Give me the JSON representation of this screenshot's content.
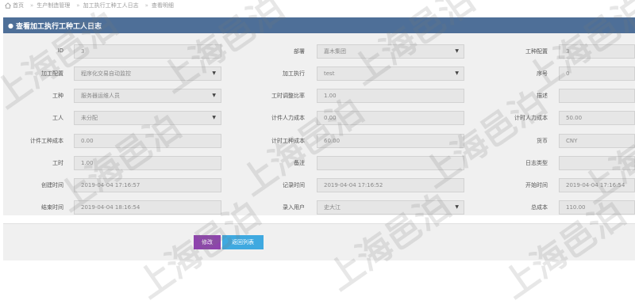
{
  "breadcrumb": [
    "首页",
    "生产制造管理",
    "加工执行工种工人日志",
    "查看明细"
  ],
  "panel_title": "查看加工执行工种工人日志",
  "rows": [
    [
      {
        "label": "ID",
        "value": "3",
        "select": false
      },
      {
        "label": "部署",
        "value": "嘉木集团",
        "select": true
      },
      {
        "label": "工种配置",
        "value": "3",
        "select": false
      }
    ],
    [
      {
        "label": "加工配置",
        "value": "程序化交易自动监控",
        "select": true
      },
      {
        "label": "加工执行",
        "value": "test",
        "select": true
      },
      {
        "label": "序号",
        "value": "0",
        "select": false
      }
    ],
    [
      {
        "label": "工种",
        "value": "服务器运维人员",
        "select": true
      },
      {
        "label": "工时调整比率",
        "value": "1.00",
        "select": false
      },
      {
        "label": "描述",
        "value": "",
        "select": false
      }
    ],
    [
      {
        "label": "工人",
        "value": "未分配",
        "select": true
      },
      {
        "label": "计件人力成本",
        "value": "0.00",
        "select": false
      },
      {
        "label": "计时人力成本",
        "value": "50.00",
        "select": false
      }
    ],
    [
      {
        "label": "计件工种成本",
        "value": "0.00",
        "select": false
      },
      {
        "label": "计时工种成本",
        "value": "60.00",
        "select": false
      },
      {
        "label": "货币",
        "value": "CNY",
        "select": false
      }
    ],
    [
      {
        "label": "工时",
        "value": "1.00",
        "select": false
      },
      {
        "label": "备注",
        "value": "",
        "select": false
      },
      {
        "label": "日志类型",
        "value": "",
        "select": false
      }
    ],
    [
      {
        "label": "创建时间",
        "value": "2019-04-04 17:16:57",
        "select": false
      },
      {
        "label": "记录时间",
        "value": "2019-04-04 17:16:52",
        "select": false
      },
      {
        "label": "开始时间",
        "value": "2019-04-04 17:16:54",
        "select": false
      }
    ],
    [
      {
        "label": "结束时间",
        "value": "2019-04-04 18:16:54",
        "select": false
      },
      {
        "label": "录入用户",
        "value": "史大江",
        "select": true
      },
      {
        "label": "总成本",
        "value": "110.00",
        "select": false
      }
    ]
  ],
  "buttons": {
    "edit": "修改",
    "back": "返回列表"
  },
  "watermark": "上海邑泊",
  "icons": {
    "home": "home-icon",
    "title": "eye-icon",
    "select": "caret-down-icon"
  }
}
